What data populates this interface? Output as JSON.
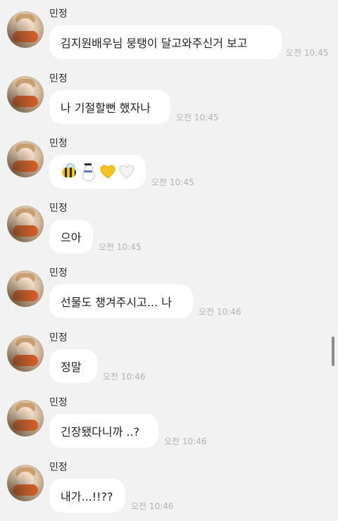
{
  "messages": [
    {
      "sender": "민정",
      "text": "김지원배우님 뭉탱이 달고와주신거 보고",
      "time": "오전 10:45"
    },
    {
      "sender": "민정",
      "text": "나 기절할뻔 했자나",
      "time": "오전 10:45"
    },
    {
      "sender": "민정",
      "emojis": [
        "bee-icon",
        "snowman-icon",
        "yellow-heart-icon",
        "white-heart-icon"
      ],
      "time": "오전 10:45"
    },
    {
      "sender": "민정",
      "text": "으아",
      "time": "오전 10:45"
    },
    {
      "sender": "민정",
      "text": "선물도 챙겨주시고... 나",
      "time": "오전 10:46"
    },
    {
      "sender": "민정",
      "text": "정말",
      "time": "오전 10:46"
    },
    {
      "sender": "민정",
      "text": "긴장됐다니까 ..?",
      "time": "오전 10:46"
    },
    {
      "sender": "민정",
      "text": "내가...!!??",
      "time": "오전 10:46"
    }
  ],
  "colors": {
    "background": "#f2f2f2",
    "bubble": "#ffffff",
    "timestamp": "#b2b2b2",
    "yellow_heart": "#f6c21c",
    "white_heart": "#f4f4f4"
  }
}
